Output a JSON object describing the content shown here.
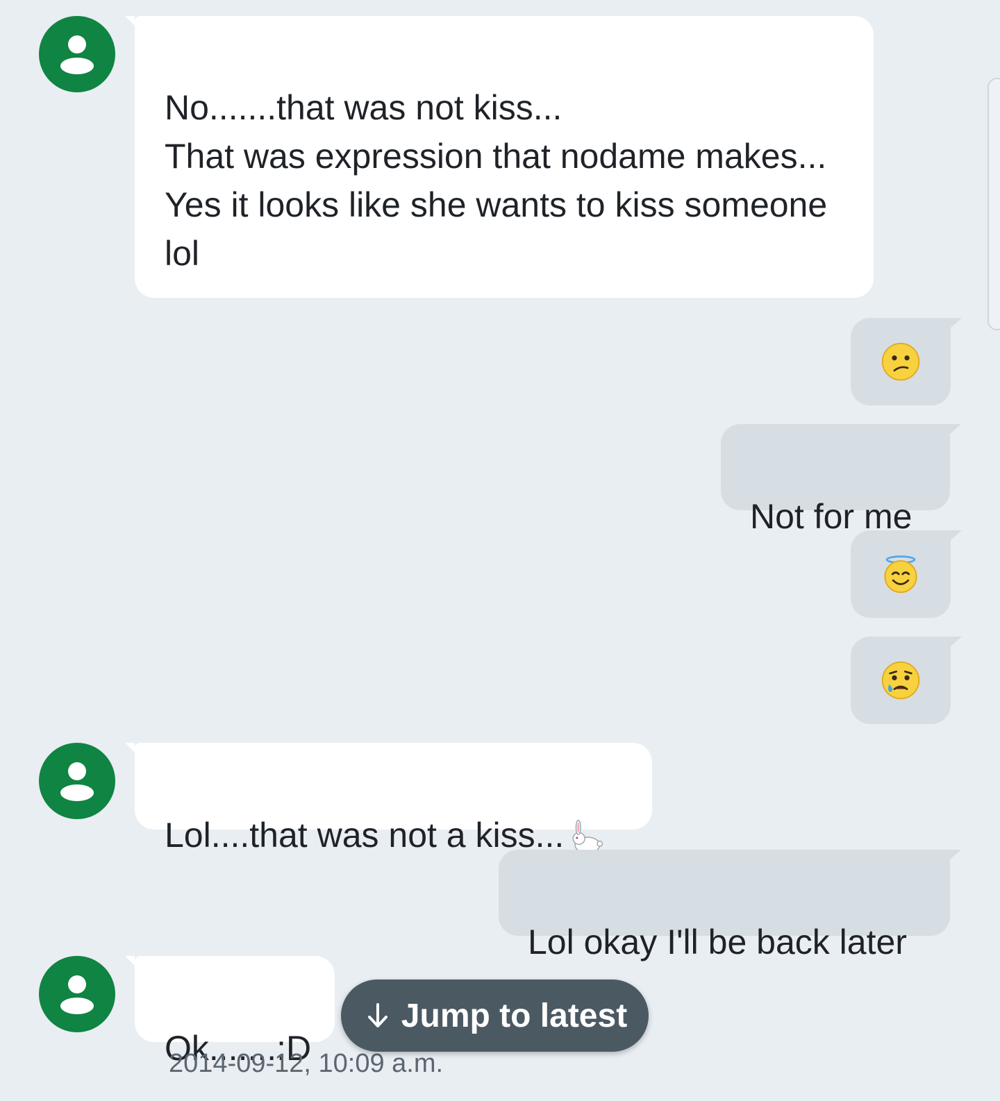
{
  "messages": [
    {
      "direction": "incoming",
      "text": "No.......that was not kiss...\nThat was expression that nodame makes...\nYes it looks like she wants to kiss someone lol"
    },
    {
      "direction": "outgoing",
      "emoji": "confused-face"
    },
    {
      "direction": "outgoing",
      "text": "Not for me"
    },
    {
      "direction": "outgoing",
      "emoji": "smiling-face-with-halo"
    },
    {
      "direction": "outgoing",
      "emoji": "sad-but-relieved-face"
    },
    {
      "direction": "incoming",
      "text": "Lol....that was not a kiss...",
      "emoji": "rabbit"
    },
    {
      "direction": "outgoing",
      "text": "Lol okay I'll be back later"
    },
    {
      "direction": "incoming",
      "text": "Ok.......:D"
    }
  ],
  "jump_button": {
    "label": "Jump to latest"
  },
  "timestamp": "2014-09-12, 10:09 a.m.",
  "colors": {
    "background": "#e9eef2",
    "avatar": "#0f8443",
    "incoming_bubble": "#ffffff",
    "outgoing_bubble": "#d6dde3",
    "jump_button": "#4b5962"
  },
  "icons": {
    "avatar": "person-icon",
    "jump": "arrow-down-icon"
  }
}
